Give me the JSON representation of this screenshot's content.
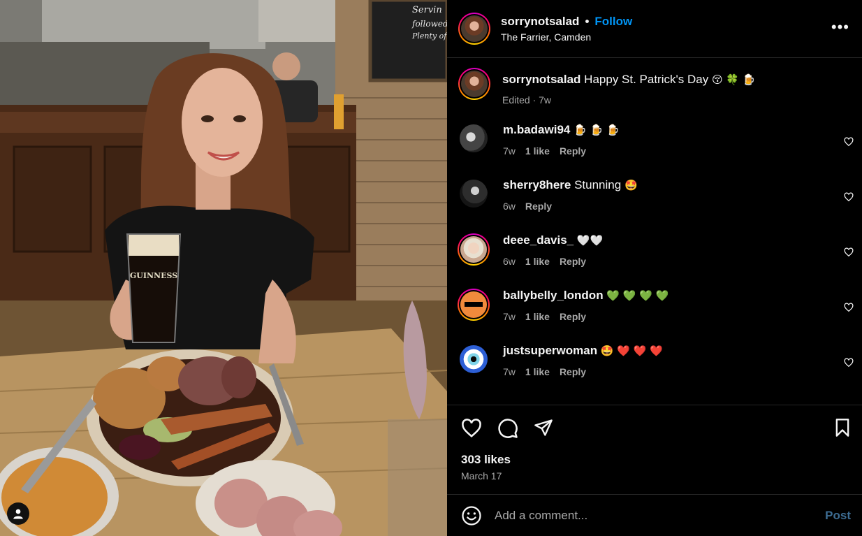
{
  "post": {
    "author": "sorrynotsalad",
    "follow_label": "Follow",
    "separator": "•",
    "location": "The Farrier, Camden",
    "more_icon": "more-horizontal-icon",
    "photo_sign_text": "Servin followed By Plenty of Goo",
    "photo_glass_text": "GUINNESS"
  },
  "caption": {
    "username": "sorrynotsalad",
    "text": "Happy St. Patrick's Day",
    "emojis": "😚 🍀 🍺",
    "meta": "Edited · 7w"
  },
  "comments": [
    {
      "username": "m.badawi94",
      "text": "",
      "emojis": "🍺 🍺 🍺",
      "time": "7w",
      "likes": "1 like",
      "reply": "Reply",
      "avatar_color": "#777777"
    },
    {
      "username": "sherry8here",
      "text": "Stunning",
      "emojis": "🤩",
      "time": "6w",
      "likes": "",
      "reply": "Reply",
      "avatar_color": "#3a3a3a"
    },
    {
      "username": "deee_davis_",
      "text": "",
      "emojis": "🤍🤍",
      "time": "6w",
      "likes": "1 like",
      "reply": "Reply",
      "avatar_color": "#c9a78f"
    },
    {
      "username": "ballybelly_london",
      "text": "",
      "emojis": "💚 💚 💚 💚",
      "time": "7w",
      "likes": "1 like",
      "reply": "Reply",
      "avatar_color": "#f08a3c"
    },
    {
      "username": "justsuperwoman",
      "text": "",
      "emojis": "🤩 ❤️ ❤️ ❤️",
      "time": "7w",
      "likes": "1 like",
      "reply": "Reply",
      "avatar_color": "#2d5fd6"
    }
  ],
  "stats": {
    "likes": "303 likes",
    "date": "March 17"
  },
  "composer": {
    "placeholder": "Add a comment...",
    "post_label": "Post"
  },
  "colors": {
    "accent": "#0095f6",
    "post_disabled": "#3d6d93",
    "muted": "#a8a8a8"
  }
}
